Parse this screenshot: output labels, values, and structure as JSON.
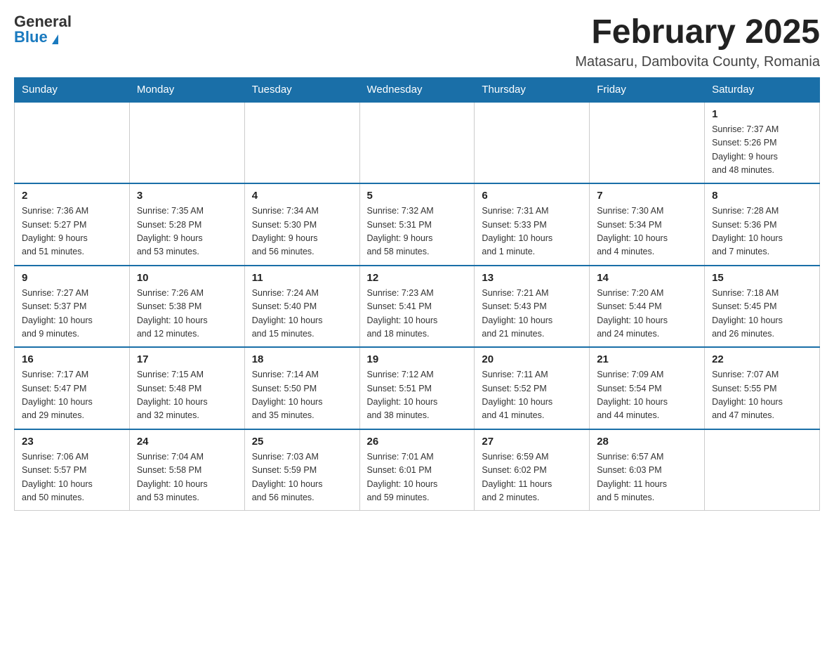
{
  "header": {
    "logo_general": "General",
    "logo_blue": "Blue",
    "title": "February 2025",
    "subtitle": "Matasaru, Dambovita County, Romania"
  },
  "weekdays": [
    "Sunday",
    "Monday",
    "Tuesday",
    "Wednesday",
    "Thursday",
    "Friday",
    "Saturday"
  ],
  "weeks": [
    [
      {
        "day": "",
        "info": ""
      },
      {
        "day": "",
        "info": ""
      },
      {
        "day": "",
        "info": ""
      },
      {
        "day": "",
        "info": ""
      },
      {
        "day": "",
        "info": ""
      },
      {
        "day": "",
        "info": ""
      },
      {
        "day": "1",
        "info": "Sunrise: 7:37 AM\nSunset: 5:26 PM\nDaylight: 9 hours\nand 48 minutes."
      }
    ],
    [
      {
        "day": "2",
        "info": "Sunrise: 7:36 AM\nSunset: 5:27 PM\nDaylight: 9 hours\nand 51 minutes."
      },
      {
        "day": "3",
        "info": "Sunrise: 7:35 AM\nSunset: 5:28 PM\nDaylight: 9 hours\nand 53 minutes."
      },
      {
        "day": "4",
        "info": "Sunrise: 7:34 AM\nSunset: 5:30 PM\nDaylight: 9 hours\nand 56 minutes."
      },
      {
        "day": "5",
        "info": "Sunrise: 7:32 AM\nSunset: 5:31 PM\nDaylight: 9 hours\nand 58 minutes."
      },
      {
        "day": "6",
        "info": "Sunrise: 7:31 AM\nSunset: 5:33 PM\nDaylight: 10 hours\nand 1 minute."
      },
      {
        "day": "7",
        "info": "Sunrise: 7:30 AM\nSunset: 5:34 PM\nDaylight: 10 hours\nand 4 minutes."
      },
      {
        "day": "8",
        "info": "Sunrise: 7:28 AM\nSunset: 5:36 PM\nDaylight: 10 hours\nand 7 minutes."
      }
    ],
    [
      {
        "day": "9",
        "info": "Sunrise: 7:27 AM\nSunset: 5:37 PM\nDaylight: 10 hours\nand 9 minutes."
      },
      {
        "day": "10",
        "info": "Sunrise: 7:26 AM\nSunset: 5:38 PM\nDaylight: 10 hours\nand 12 minutes."
      },
      {
        "day": "11",
        "info": "Sunrise: 7:24 AM\nSunset: 5:40 PM\nDaylight: 10 hours\nand 15 minutes."
      },
      {
        "day": "12",
        "info": "Sunrise: 7:23 AM\nSunset: 5:41 PM\nDaylight: 10 hours\nand 18 minutes."
      },
      {
        "day": "13",
        "info": "Sunrise: 7:21 AM\nSunset: 5:43 PM\nDaylight: 10 hours\nand 21 minutes."
      },
      {
        "day": "14",
        "info": "Sunrise: 7:20 AM\nSunset: 5:44 PM\nDaylight: 10 hours\nand 24 minutes."
      },
      {
        "day": "15",
        "info": "Sunrise: 7:18 AM\nSunset: 5:45 PM\nDaylight: 10 hours\nand 26 minutes."
      }
    ],
    [
      {
        "day": "16",
        "info": "Sunrise: 7:17 AM\nSunset: 5:47 PM\nDaylight: 10 hours\nand 29 minutes."
      },
      {
        "day": "17",
        "info": "Sunrise: 7:15 AM\nSunset: 5:48 PM\nDaylight: 10 hours\nand 32 minutes."
      },
      {
        "day": "18",
        "info": "Sunrise: 7:14 AM\nSunset: 5:50 PM\nDaylight: 10 hours\nand 35 minutes."
      },
      {
        "day": "19",
        "info": "Sunrise: 7:12 AM\nSunset: 5:51 PM\nDaylight: 10 hours\nand 38 minutes."
      },
      {
        "day": "20",
        "info": "Sunrise: 7:11 AM\nSunset: 5:52 PM\nDaylight: 10 hours\nand 41 minutes."
      },
      {
        "day": "21",
        "info": "Sunrise: 7:09 AM\nSunset: 5:54 PM\nDaylight: 10 hours\nand 44 minutes."
      },
      {
        "day": "22",
        "info": "Sunrise: 7:07 AM\nSunset: 5:55 PM\nDaylight: 10 hours\nand 47 minutes."
      }
    ],
    [
      {
        "day": "23",
        "info": "Sunrise: 7:06 AM\nSunset: 5:57 PM\nDaylight: 10 hours\nand 50 minutes."
      },
      {
        "day": "24",
        "info": "Sunrise: 7:04 AM\nSunset: 5:58 PM\nDaylight: 10 hours\nand 53 minutes."
      },
      {
        "day": "25",
        "info": "Sunrise: 7:03 AM\nSunset: 5:59 PM\nDaylight: 10 hours\nand 56 minutes."
      },
      {
        "day": "26",
        "info": "Sunrise: 7:01 AM\nSunset: 6:01 PM\nDaylight: 10 hours\nand 59 minutes."
      },
      {
        "day": "27",
        "info": "Sunrise: 6:59 AM\nSunset: 6:02 PM\nDaylight: 11 hours\nand 2 minutes."
      },
      {
        "day": "28",
        "info": "Sunrise: 6:57 AM\nSunset: 6:03 PM\nDaylight: 11 hours\nand 5 minutes."
      },
      {
        "day": "",
        "info": ""
      }
    ]
  ]
}
